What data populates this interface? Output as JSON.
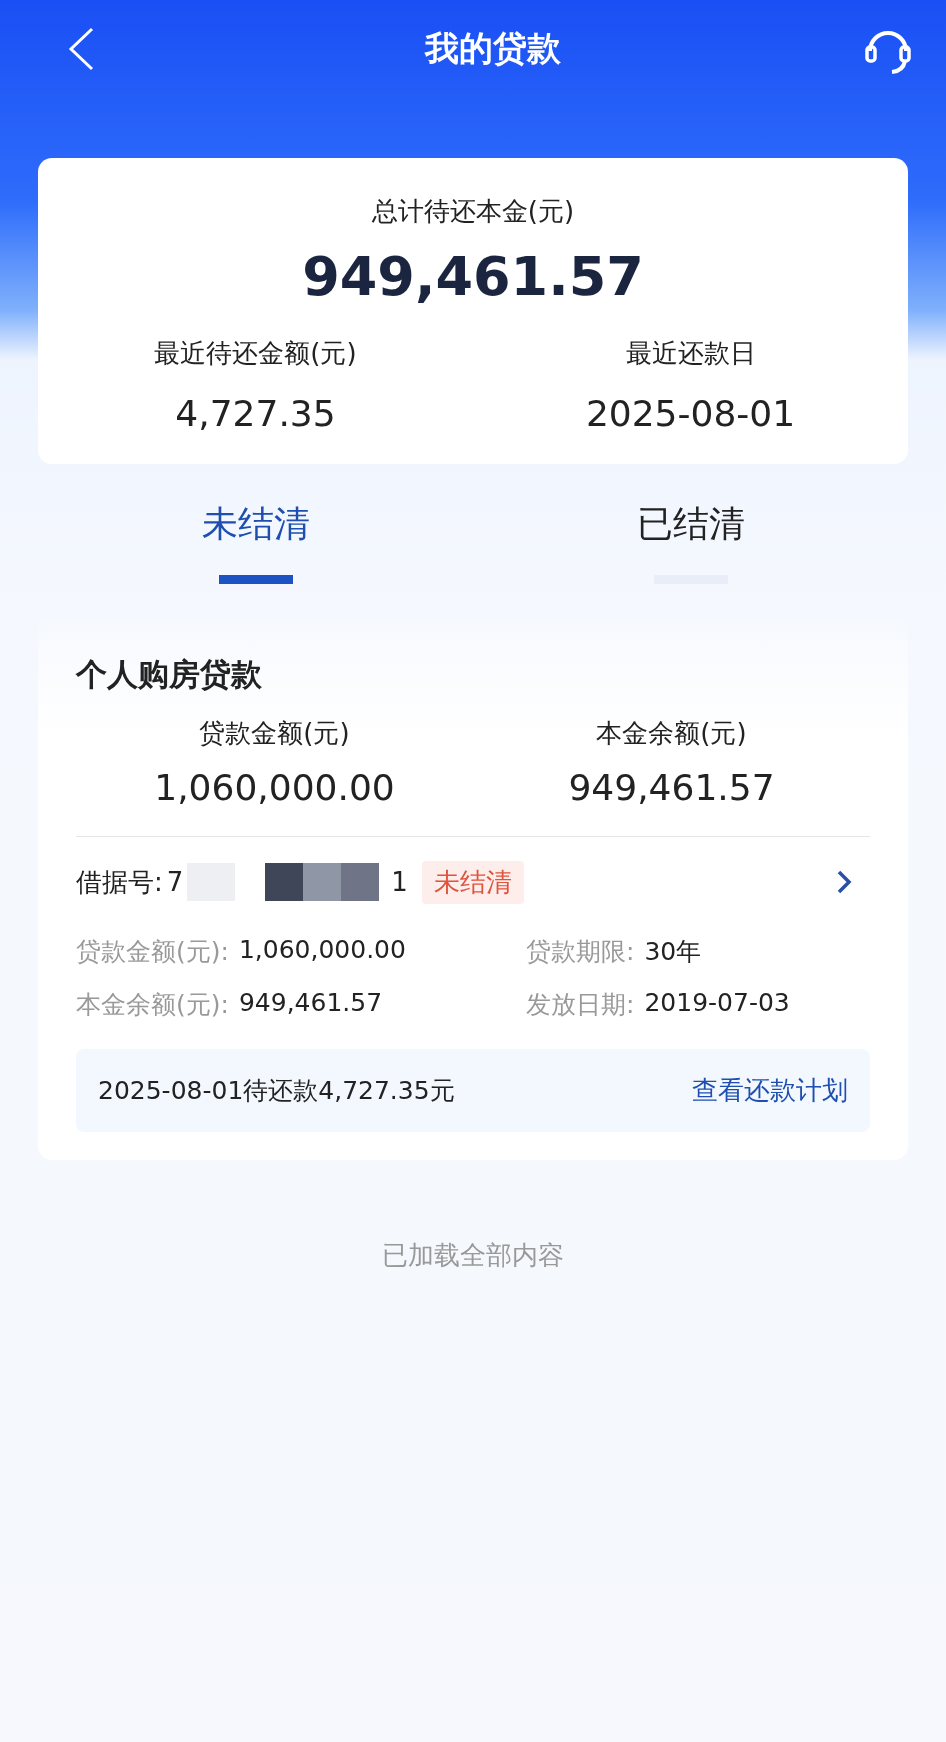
{
  "header": {
    "title": "我的贷款"
  },
  "summary": {
    "label": "总计待还本金(元)",
    "amount": "949,461.57",
    "items": [
      {
        "label": "最近待还金额(元)",
        "value": "4,727.35"
      },
      {
        "label": "最近还款日",
        "value": "2025-08-01"
      }
    ]
  },
  "tabs": [
    {
      "label": "未结清",
      "selected": true
    },
    {
      "label": "已结清",
      "selected": false
    }
  ],
  "loans": [
    {
      "title": "个人购房贷款",
      "amounts": [
        {
          "label": "贷款金额(元)",
          "value": "1,060,000.00"
        },
        {
          "label": "本金余额(元)",
          "value": "949,461.57"
        }
      ],
      "loan_number": {
        "label": "借据号:",
        "visible_start": "7",
        "visible_end": "1"
      },
      "status": "未结清",
      "details": [
        {
          "label": "贷款金额(元):",
          "value": "1,060,000.00"
        },
        {
          "label": "贷款期限:",
          "value": "30年"
        },
        {
          "label": "本金余额(元):",
          "value": "949,461.57"
        },
        {
          "label": "发放日期:",
          "value": "2019-07-03"
        }
      ],
      "due_text": "2025-08-01待还款4,727.35元",
      "plan_link": "查看还款计划"
    }
  ],
  "footer": "已加载全部内容"
}
